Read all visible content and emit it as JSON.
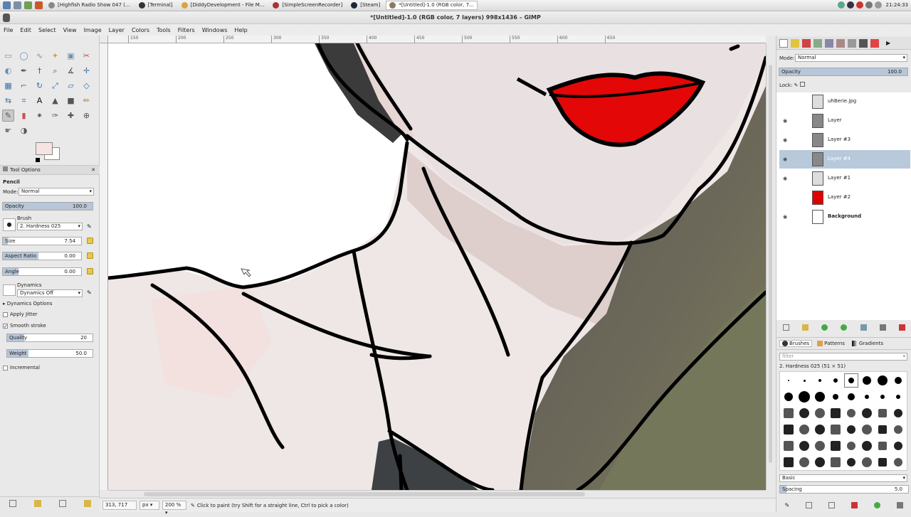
{
  "taskbar": {
    "tasks": [
      {
        "label": "[Highfish Radio Show 047 (..."
      },
      {
        "label": "[Terminal]"
      },
      {
        "label": "[DiddyDevelopment - File M..."
      },
      {
        "label": "[SimpleScreenRecorder]"
      },
      {
        "label": "[Steam]"
      },
      {
        "label": "*[Untitled]-1.0 (RGB color, 7..."
      }
    ],
    "active_index": 5,
    "clock": "21:24:33"
  },
  "window": {
    "title": "*[Untitled]-1.0 (RGB color, 7 layers) 998x1436 – GIMP"
  },
  "menubar": {
    "items": [
      "File",
      "Edit",
      "Select",
      "View",
      "Image",
      "Layer",
      "Colors",
      "Tools",
      "Filters",
      "Windows",
      "Help"
    ]
  },
  "ruler": {
    "top_ticks": [
      "150",
      "200",
      "250",
      "300",
      "350",
      "400",
      "450",
      "500",
      "550",
      "600",
      "650"
    ]
  },
  "toolbox": {
    "tools": [
      "rect-select-icon",
      "ellipse-select-icon",
      "free-select-icon",
      "fuzzy-select-icon",
      "color-select-icon",
      "scissors-icon",
      "foreground-select-icon",
      "paths-icon",
      "color-picker-icon",
      "zoom-icon",
      "measure-icon",
      "move-icon",
      "align-icon",
      "crop-icon",
      "rotate-icon",
      "scale-icon",
      "shear-icon",
      "perspective-icon",
      "flip-icon",
      "cage-icon",
      "text-icon",
      "bucket-fill-icon",
      "blend-icon",
      "pencil-icon",
      "paintbrush-icon",
      "eraser-icon",
      "airbrush-icon",
      "ink-icon",
      "heal-icon",
      "clone-icon",
      "smudge-icon",
      "dodge-burn-icon"
    ],
    "active_tool": "paintbrush-icon",
    "fg_color": "#f6e4e2",
    "bg_color": "#ffffff"
  },
  "tool_options": {
    "tab_label": "Tool Options",
    "section": "Pencil",
    "mode_label": "Mode:",
    "mode_value": "Normal",
    "opacity_label": "Opacity",
    "opacity_value": "100.0",
    "brush_label": "Brush",
    "brush_value": "2. Hardness 025",
    "size_label": "Size",
    "size_value": "7.54",
    "aspect_label": "Aspect Ratio",
    "aspect_value": "0.00",
    "angle_label": "Angle",
    "angle_value": "0.00",
    "dynamics_label": "Dynamics",
    "dynamics_value": "Dynamics Off",
    "dynamics_options": "Dynamics Options",
    "apply_jitter": "Apply Jitter",
    "smooth_stroke": "Smooth stroke",
    "quality_label": "Quality",
    "quality_value": "20",
    "weight_label": "Weight",
    "weight_value": "50.0",
    "incremental": "Incremental"
  },
  "layers": {
    "mode_label": "Mode:",
    "mode_value": "Normal",
    "opacity_label": "Opacity",
    "opacity_value": "100.0",
    "lock_label": "Lock:",
    "items": [
      {
        "name": "uhBerie.jpg",
        "visible": false,
        "thumb": "#ddd"
      },
      {
        "name": "Layer",
        "visible": true,
        "thumb": "#888"
      },
      {
        "name": "Layer #3",
        "visible": true,
        "thumb": "#888"
      },
      {
        "name": "Layer #4",
        "visible": true,
        "thumb": "#888",
        "selected": true
      },
      {
        "name": "Layer #1",
        "visible": true,
        "thumb": "#ddd"
      },
      {
        "name": "Layer #2",
        "visible": false,
        "thumb": "#e00000"
      },
      {
        "name": "Background",
        "visible": true,
        "thumb": "#ffffff"
      }
    ]
  },
  "brushes": {
    "tabs": [
      "Brushes",
      "Patterns",
      "Gradients"
    ],
    "filter_placeholder": "filter",
    "current_brush": "2. Hardness 025 (51 × 51)",
    "tag": "Basic",
    "spacing_label": "Spacing",
    "spacing_value": "5.0"
  },
  "status": {
    "coords": "313, 717",
    "unit": "px",
    "zoom": "200 %",
    "message": "Click to paint (try Shift for a straight line, Ctrl to pick a color)"
  }
}
